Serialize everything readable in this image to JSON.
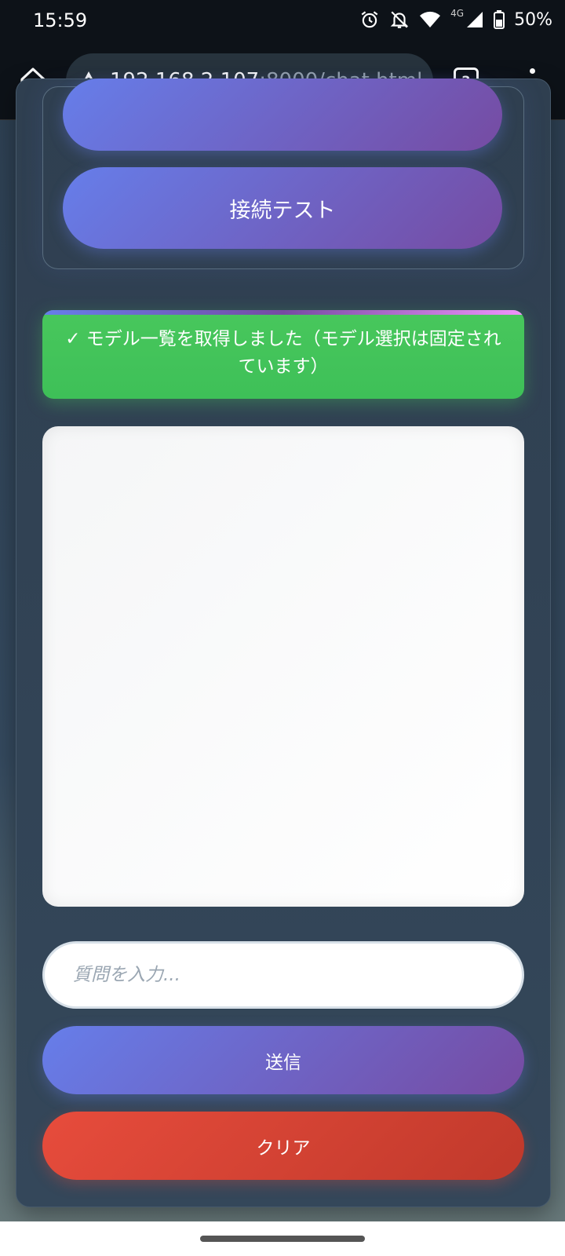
{
  "status_bar": {
    "time": "15:59",
    "network": "4G",
    "battery": "50%",
    "icons": [
      "alarm-icon",
      "notifications-off-icon",
      "wifi-icon",
      "signal-icon",
      "battery-icon"
    ]
  },
  "browser": {
    "url_host": "192.168.2.107",
    "url_path": ":8000/chat.html",
    "tab_count": "2",
    "icons": [
      "home-icon",
      "warning-icon",
      "tabs-icon",
      "more-menu-icon"
    ]
  },
  "settings": {
    "test_button_label": "接続テスト"
  },
  "status_message": "✓ モデル一覧を取得しました（モデル選択は固定されています）",
  "chat": {
    "input_placeholder": "質問を入力...",
    "send_label": "送信",
    "clear_label": "クリア"
  },
  "colors": {
    "accent_gradient_start": "#667eea",
    "accent_gradient_end": "#764ba2",
    "success": "#48c75c",
    "danger": "#e74c3c"
  }
}
